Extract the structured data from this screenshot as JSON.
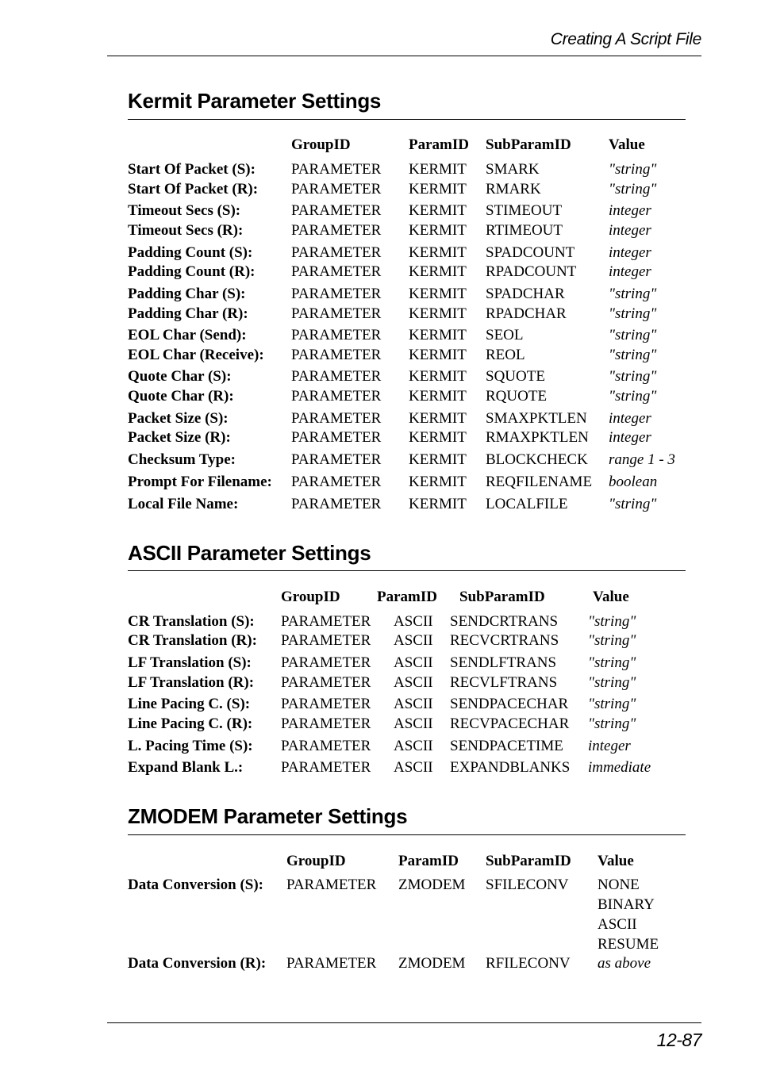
{
  "header": {
    "running_title": "Creating A Script File"
  },
  "footer": {
    "page_number": "12-87"
  },
  "sections": {
    "kermit": {
      "title": "Kermit Parameter Settings",
      "columns": [
        "GroupID",
        "ParamID",
        "SubParamID",
        "Value"
      ],
      "rows": [
        {
          "label": "Start Of Packet (S):",
          "group": "PARAMETER",
          "param": "KERMIT",
          "subparam": "SMARK",
          "value": "\"string\""
        },
        {
          "label": "Start Of Packet (R):",
          "group": "PARAMETER",
          "param": "KERMIT",
          "subparam": "RMARK",
          "value": "\"string\""
        },
        {
          "label": "Timeout Secs (S):",
          "group": "PARAMETER",
          "param": "KERMIT",
          "subparam": "STIMEOUT",
          "value": "integer"
        },
        {
          "label": "Timeout Secs (R):",
          "group": "PARAMETER",
          "param": "KERMIT",
          "subparam": "RTIMEOUT",
          "value": "integer"
        },
        {
          "label": "Padding Count (S):",
          "group": "PARAMETER",
          "param": "KERMIT",
          "subparam": "SPADCOUNT",
          "value": "integer"
        },
        {
          "label": "Padding Count (R):",
          "group": "PARAMETER",
          "param": "KERMIT",
          "subparam": "RPADCOUNT",
          "value": "integer"
        },
        {
          "label": "Padding Char (S):",
          "group": "PARAMETER",
          "param": "KERMIT",
          "subparam": "SPADCHAR",
          "value": "\"string\""
        },
        {
          "label": "Padding Char (R):",
          "group": "PARAMETER",
          "param": "KERMIT",
          "subparam": "RPADCHAR",
          "value": "\"string\""
        },
        {
          "label": "EOL Char (Send):",
          "group": "PARAMETER",
          "param": "KERMIT",
          "subparam": "SEOL",
          "value": "\"string\""
        },
        {
          "label": "EOL Char (Receive):",
          "group": "PARAMETER",
          "param": "KERMIT",
          "subparam": "REOL",
          "value": "\"string\""
        },
        {
          "label": "Quote Char (S):",
          "group": "PARAMETER",
          "param": "KERMIT",
          "subparam": "SQUOTE",
          "value": "\"string\""
        },
        {
          "label": "Quote Char (R):",
          "group": "PARAMETER",
          "param": "KERMIT",
          "subparam": "RQUOTE",
          "value": "\"string\""
        },
        {
          "label": "Packet Size (S):",
          "group": "PARAMETER",
          "param": "KERMIT",
          "subparam": "SMAXPKTLEN",
          "value": "integer"
        },
        {
          "label": "Packet Size (R):",
          "group": "PARAMETER",
          "param": "KERMIT",
          "subparam": "RMAXPKTLEN",
          "value": "integer"
        },
        {
          "label": "Checksum Type:",
          "group": "PARAMETER",
          "param": "KERMIT",
          "subparam": "BLOCKCHECK",
          "value": "range 1 - 3"
        },
        {
          "label": "Prompt For Filename:",
          "group": "PARAMETER",
          "param": "KERMIT",
          "subparam": "REQFILENAME",
          "value": "boolean"
        },
        {
          "label": "Local File Name:",
          "group": "PARAMETER",
          "param": "KERMIT",
          "subparam": "LOCALFILE",
          "value": "\"string\""
        }
      ]
    },
    "ascii": {
      "title": "ASCII Parameter Settings",
      "columns": [
        "GroupID",
        "ParamID",
        "SubParamID",
        "Value"
      ],
      "rows": [
        {
          "label": "CR Translation (S):",
          "group": "PARAMETER",
          "param": "ASCII",
          "subparam": "SENDCRTRANS",
          "value": "\"string\""
        },
        {
          "label": "CR Translation (R):",
          "group": "PARAMETER",
          "param": "ASCII",
          "subparam": "RECVCRTRANS",
          "value": "\"string\""
        },
        {
          "label": "LF Translation (S):",
          "group": "PARAMETER",
          "param": "ASCII",
          "subparam": "SENDLFTRANS",
          "value": "\"string\""
        },
        {
          "label": "LF Translation (R):",
          "group": "PARAMETER",
          "param": "ASCII",
          "subparam": "RECVLFTRANS",
          "value": "\"string\""
        },
        {
          "label": "Line Pacing C. (S):",
          "group": "PARAMETER",
          "param": "ASCII",
          "subparam": "SENDPACECHAR",
          "value": "\"string\""
        },
        {
          "label": "Line Pacing C. (R):",
          "group": "PARAMETER",
          "param": "ASCII",
          "subparam": "RECVPACECHAR",
          "value": "\"string\""
        },
        {
          "label": "L. Pacing Time (S):",
          "group": "PARAMETER",
          "param": "ASCII",
          "subparam": "SENDPACETIME",
          "value": "integer"
        },
        {
          "label": "Expand Blank L.:",
          "group": "PARAMETER",
          "param": "ASCII",
          "subparam": "EXPANDBLANKS",
          "value": "immediate"
        }
      ]
    },
    "zmodem": {
      "title": "ZMODEM Parameter Settings",
      "columns": [
        "GroupID",
        "ParamID",
        "SubParamID",
        "Value"
      ],
      "rows": [
        {
          "label": "Data Conversion (S):",
          "group": "PARAMETER",
          "param": "ZMODEM",
          "subparam": "SFILECONV",
          "value": "NONE",
          "value_extra": [
            "BINARY",
            "ASCII",
            "RESUME"
          ]
        },
        {
          "label": "Data Conversion (R):",
          "group": "PARAMETER",
          "param": "ZMODEM",
          "subparam": "RFILECONV",
          "value": "as above"
        }
      ]
    }
  }
}
